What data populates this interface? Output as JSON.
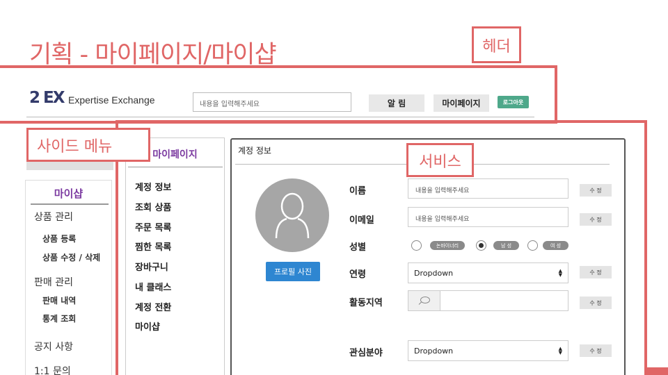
{
  "slide": {
    "title": "기획 - 마이페이지/마이샵",
    "callouts": {
      "header": "헤더",
      "side_menu": "사이드 메뉴",
      "service": "서비스"
    }
  },
  "colors": {
    "accent": "#e06666",
    "purple": "#7b3aa0",
    "blue_button": "#2e86d1",
    "logout_green": "#4ea88a"
  },
  "header": {
    "logo": "2 EX",
    "brand": "Expertise Exchange",
    "search_placeholder": "내용을 입력해주세요",
    "alarm_label": "알 림",
    "mypage_label": "마이페이지",
    "logout_label": "로그아웃"
  },
  "sidebar": {
    "title": "마이샵",
    "sections": [
      {
        "label": "상품 관리",
        "items": [
          "상품 등록",
          "상품 수정 / 삭제"
        ]
      },
      {
        "label": "판매 관리",
        "items": [
          "판매 내역",
          "통계 조회"
        ]
      },
      {
        "label": "공지 사항",
        "items": []
      },
      {
        "label": "1:1 문의",
        "items": []
      }
    ]
  },
  "mypage_menu": {
    "title": "마이페이지",
    "items": [
      "계정 정보",
      "조회 상품",
      "주문 목록",
      "찜한 목록",
      "장바구니",
      "내 클래스",
      "계정 전환",
      "마이샵"
    ]
  },
  "account": {
    "title": "계정 정보",
    "photo_button": "프로필 사진",
    "edit_label": "수 정",
    "avatar_icon": "user-silhouette-icon",
    "fields": {
      "name": {
        "label": "이름",
        "placeholder": "내용을 입력해주세요"
      },
      "email": {
        "label": "이메일",
        "placeholder": "내용을 입력해주세요"
      },
      "gender": {
        "label": "성별",
        "options": [
          "논바이너리",
          "남 성",
          "여 성"
        ],
        "selected": "남 성"
      },
      "age": {
        "label": "연령",
        "value": "Dropdown"
      },
      "region": {
        "label": "활동지역",
        "value": ""
      },
      "interest": {
        "label": "관심분야",
        "value": "Dropdown"
      }
    }
  }
}
